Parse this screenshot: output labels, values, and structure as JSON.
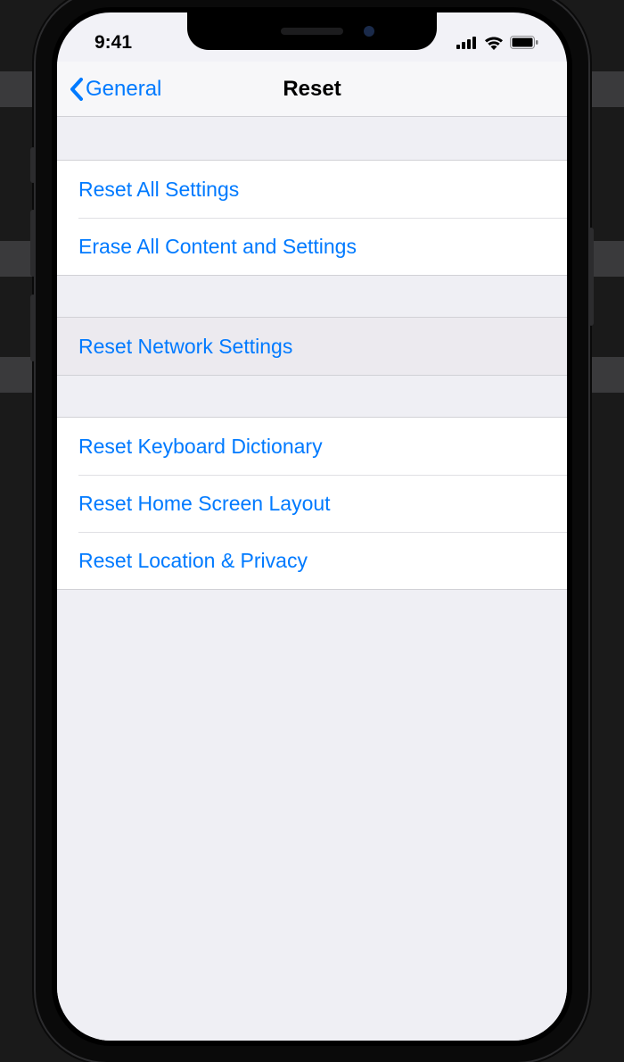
{
  "status": {
    "time": "9:41"
  },
  "nav": {
    "back_label": "General",
    "title": "Reset"
  },
  "groups": [
    {
      "items": [
        {
          "label": "Reset All Settings"
        },
        {
          "label": "Erase All Content and Settings"
        }
      ]
    },
    {
      "items": [
        {
          "label": "Reset Network Settings",
          "highlight": true
        }
      ]
    },
    {
      "items": [
        {
          "label": "Reset Keyboard Dictionary"
        },
        {
          "label": "Reset Home Screen Layout"
        },
        {
          "label": "Reset Location & Privacy"
        }
      ]
    }
  ],
  "colors": {
    "link": "#007aff",
    "bg": "#efeff4"
  }
}
